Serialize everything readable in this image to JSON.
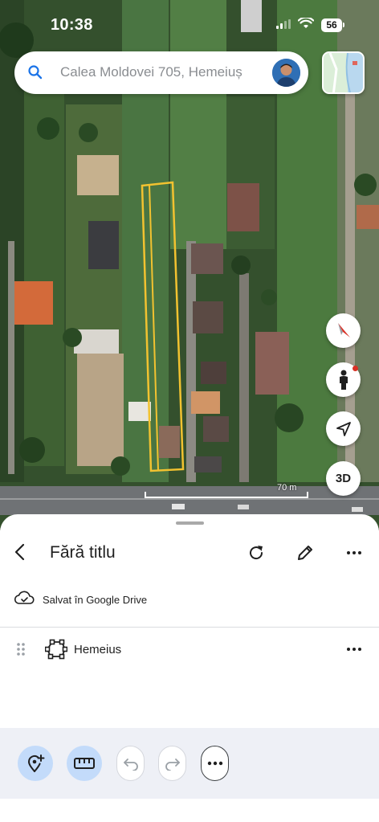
{
  "status_bar": {
    "time": "10:38",
    "battery": "56",
    "icons": [
      "signal-icon",
      "wifi-icon",
      "battery-icon"
    ]
  },
  "search": {
    "query": "Calea Moldovei 705, Hemeiuș"
  },
  "map": {
    "controls": {
      "three_d_label": "3D"
    },
    "scale_label": "70 m",
    "highlight_color": "#f2c230"
  },
  "sheet": {
    "title": "Fără titlu",
    "saved_status": "Salvat în Google Drive",
    "features": [
      {
        "name": "Hemeius",
        "icon": "polygon-icon"
      }
    ]
  },
  "toolbar": {
    "tools": [
      "add-point-icon",
      "ruler-icon",
      "undo-icon",
      "redo-icon",
      "more-horizontal-icon"
    ]
  },
  "colors": {
    "accent_light": "#c3dbfa",
    "toolbar_bg": "#eef0f6",
    "text_primary": "#1f1f1f",
    "text_secondary": "#8a8d91"
  }
}
